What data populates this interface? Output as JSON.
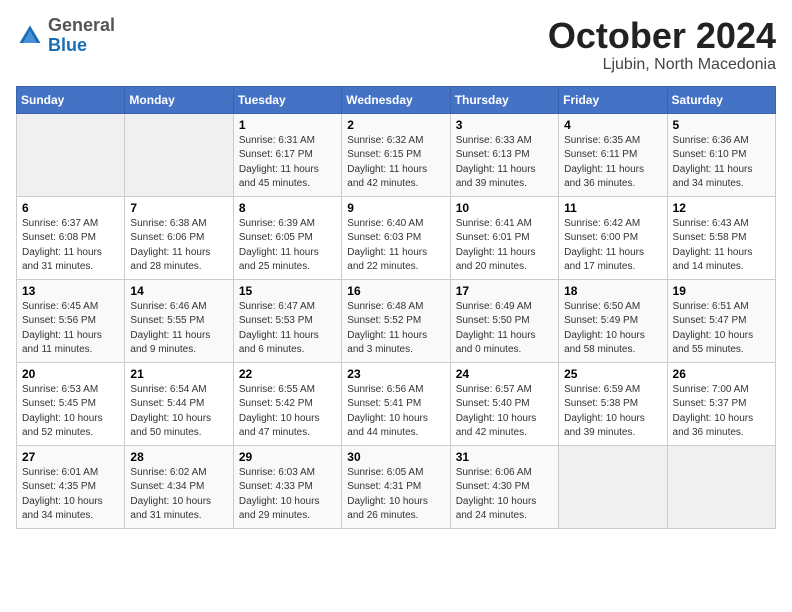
{
  "header": {
    "logo_general": "General",
    "logo_blue": "Blue",
    "month": "October 2024",
    "location": "Ljubin, North Macedonia"
  },
  "weekdays": [
    "Sunday",
    "Monday",
    "Tuesday",
    "Wednesday",
    "Thursday",
    "Friday",
    "Saturday"
  ],
  "weeks": [
    [
      {
        "day": "",
        "info": ""
      },
      {
        "day": "",
        "info": ""
      },
      {
        "day": "1",
        "info": "Sunrise: 6:31 AM\nSunset: 6:17 PM\nDaylight: 11 hours\nand 45 minutes."
      },
      {
        "day": "2",
        "info": "Sunrise: 6:32 AM\nSunset: 6:15 PM\nDaylight: 11 hours\nand 42 minutes."
      },
      {
        "day": "3",
        "info": "Sunrise: 6:33 AM\nSunset: 6:13 PM\nDaylight: 11 hours\nand 39 minutes."
      },
      {
        "day": "4",
        "info": "Sunrise: 6:35 AM\nSunset: 6:11 PM\nDaylight: 11 hours\nand 36 minutes."
      },
      {
        "day": "5",
        "info": "Sunrise: 6:36 AM\nSunset: 6:10 PM\nDaylight: 11 hours\nand 34 minutes."
      }
    ],
    [
      {
        "day": "6",
        "info": "Sunrise: 6:37 AM\nSunset: 6:08 PM\nDaylight: 11 hours\nand 31 minutes."
      },
      {
        "day": "7",
        "info": "Sunrise: 6:38 AM\nSunset: 6:06 PM\nDaylight: 11 hours\nand 28 minutes."
      },
      {
        "day": "8",
        "info": "Sunrise: 6:39 AM\nSunset: 6:05 PM\nDaylight: 11 hours\nand 25 minutes."
      },
      {
        "day": "9",
        "info": "Sunrise: 6:40 AM\nSunset: 6:03 PM\nDaylight: 11 hours\nand 22 minutes."
      },
      {
        "day": "10",
        "info": "Sunrise: 6:41 AM\nSunset: 6:01 PM\nDaylight: 11 hours\nand 20 minutes."
      },
      {
        "day": "11",
        "info": "Sunrise: 6:42 AM\nSunset: 6:00 PM\nDaylight: 11 hours\nand 17 minutes."
      },
      {
        "day": "12",
        "info": "Sunrise: 6:43 AM\nSunset: 5:58 PM\nDaylight: 11 hours\nand 14 minutes."
      }
    ],
    [
      {
        "day": "13",
        "info": "Sunrise: 6:45 AM\nSunset: 5:56 PM\nDaylight: 11 hours\nand 11 minutes."
      },
      {
        "day": "14",
        "info": "Sunrise: 6:46 AM\nSunset: 5:55 PM\nDaylight: 11 hours\nand 9 minutes."
      },
      {
        "day": "15",
        "info": "Sunrise: 6:47 AM\nSunset: 5:53 PM\nDaylight: 11 hours\nand 6 minutes."
      },
      {
        "day": "16",
        "info": "Sunrise: 6:48 AM\nSunset: 5:52 PM\nDaylight: 11 hours\nand 3 minutes."
      },
      {
        "day": "17",
        "info": "Sunrise: 6:49 AM\nSunset: 5:50 PM\nDaylight: 11 hours\nand 0 minutes."
      },
      {
        "day": "18",
        "info": "Sunrise: 6:50 AM\nSunset: 5:49 PM\nDaylight: 10 hours\nand 58 minutes."
      },
      {
        "day": "19",
        "info": "Sunrise: 6:51 AM\nSunset: 5:47 PM\nDaylight: 10 hours\nand 55 minutes."
      }
    ],
    [
      {
        "day": "20",
        "info": "Sunrise: 6:53 AM\nSunset: 5:45 PM\nDaylight: 10 hours\nand 52 minutes."
      },
      {
        "day": "21",
        "info": "Sunrise: 6:54 AM\nSunset: 5:44 PM\nDaylight: 10 hours\nand 50 minutes."
      },
      {
        "day": "22",
        "info": "Sunrise: 6:55 AM\nSunset: 5:42 PM\nDaylight: 10 hours\nand 47 minutes."
      },
      {
        "day": "23",
        "info": "Sunrise: 6:56 AM\nSunset: 5:41 PM\nDaylight: 10 hours\nand 44 minutes."
      },
      {
        "day": "24",
        "info": "Sunrise: 6:57 AM\nSunset: 5:40 PM\nDaylight: 10 hours\nand 42 minutes."
      },
      {
        "day": "25",
        "info": "Sunrise: 6:59 AM\nSunset: 5:38 PM\nDaylight: 10 hours\nand 39 minutes."
      },
      {
        "day": "26",
        "info": "Sunrise: 7:00 AM\nSunset: 5:37 PM\nDaylight: 10 hours\nand 36 minutes."
      }
    ],
    [
      {
        "day": "27",
        "info": "Sunrise: 6:01 AM\nSunset: 4:35 PM\nDaylight: 10 hours\nand 34 minutes."
      },
      {
        "day": "28",
        "info": "Sunrise: 6:02 AM\nSunset: 4:34 PM\nDaylight: 10 hours\nand 31 minutes."
      },
      {
        "day": "29",
        "info": "Sunrise: 6:03 AM\nSunset: 4:33 PM\nDaylight: 10 hours\nand 29 minutes."
      },
      {
        "day": "30",
        "info": "Sunrise: 6:05 AM\nSunset: 4:31 PM\nDaylight: 10 hours\nand 26 minutes."
      },
      {
        "day": "31",
        "info": "Sunrise: 6:06 AM\nSunset: 4:30 PM\nDaylight: 10 hours\nand 24 minutes."
      },
      {
        "day": "",
        "info": ""
      },
      {
        "day": "",
        "info": ""
      }
    ]
  ]
}
